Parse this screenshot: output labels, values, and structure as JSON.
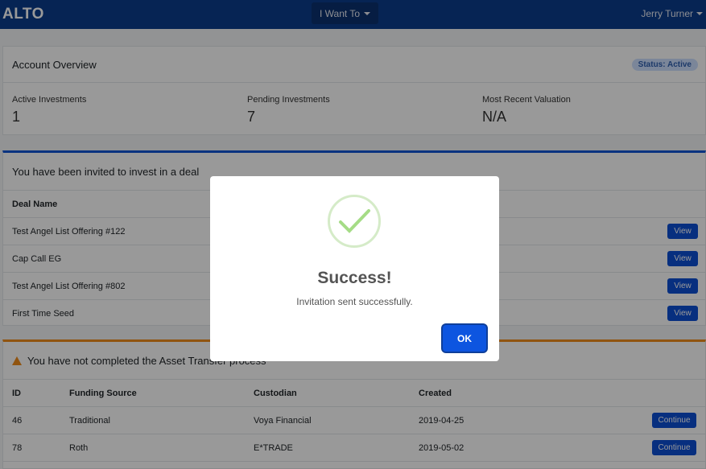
{
  "nav": {
    "brand": "ALTO",
    "menu_label": "I Want To",
    "user_name": "Jerry Turner"
  },
  "overview": {
    "title": "Account Overview",
    "status": "Status: Active",
    "stats": [
      {
        "label": "Active Investments",
        "value": "1"
      },
      {
        "label": "Pending Investments",
        "value": "7"
      },
      {
        "label": "Most Recent Valuation",
        "value": "N/A"
      }
    ]
  },
  "deals": {
    "title": "You have been invited to invest in a deal",
    "column": "Deal Name",
    "view_label": "View",
    "rows": [
      "Test Angel List Offering #122",
      "Cap Call EG",
      "Test Angel List Offering #802",
      "First Time Seed"
    ]
  },
  "asset": {
    "title": "You have not completed the Asset Transfer process",
    "columns": [
      "ID",
      "Funding Source",
      "Custodian",
      "Created"
    ],
    "continue_label": "Continue",
    "rows": [
      {
        "id": "46",
        "source": "Traditional",
        "custodian": "Voya Financial",
        "created": "2019-04-25"
      },
      {
        "id": "78",
        "source": "Roth",
        "custodian": "E*TRADE",
        "created": "2019-05-02"
      }
    ]
  },
  "modal": {
    "title": "Success!",
    "message": "Invitation sent successfully.",
    "ok_label": "OK",
    "icon": "check-icon"
  },
  "colors": {
    "navbar": "#0b3d8c",
    "primary": "#0d55e0",
    "warning": "#f08c1c",
    "success_icon": "#a5dc86"
  }
}
